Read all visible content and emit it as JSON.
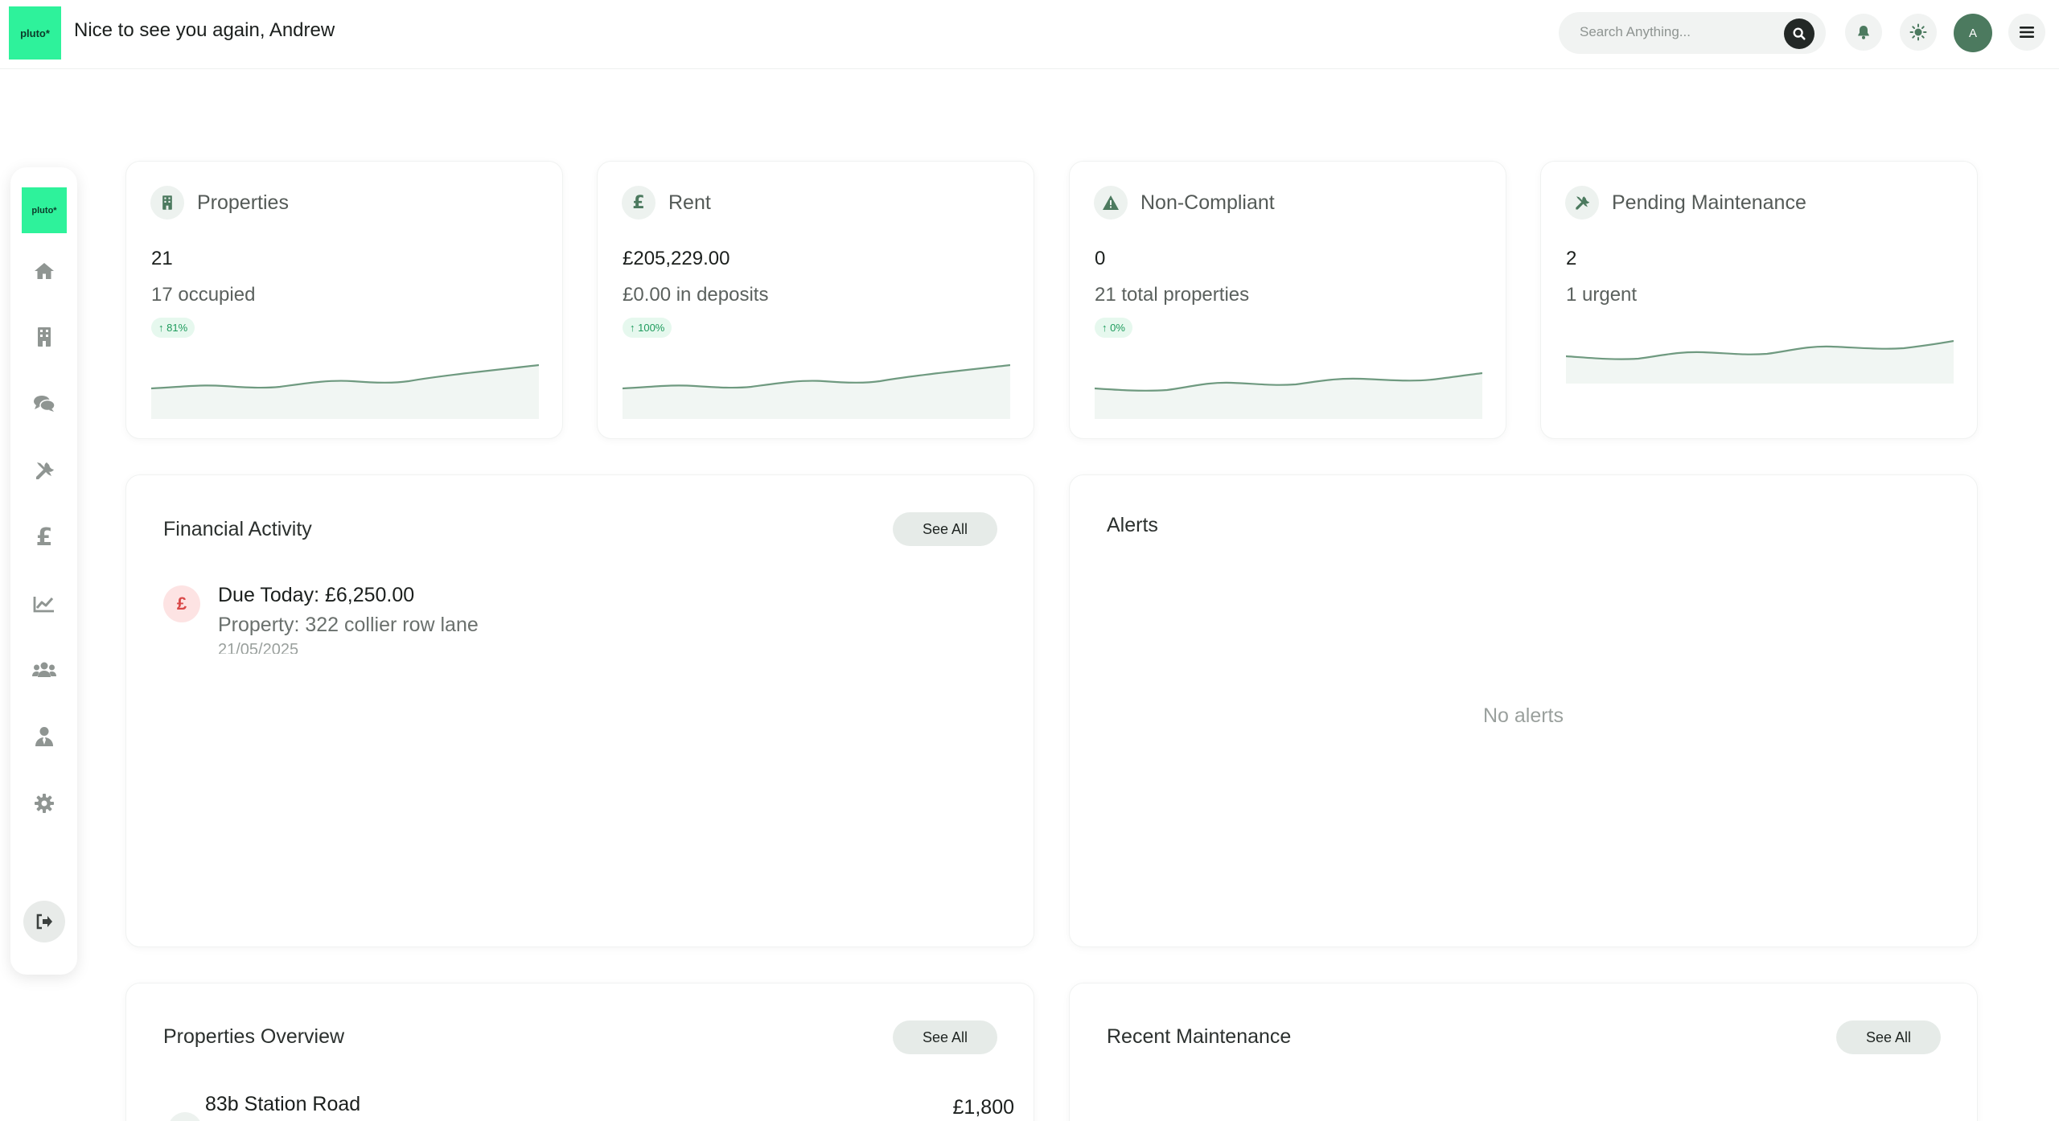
{
  "header": {
    "logo_text": "pluto*",
    "welcome": "Nice to see you again, Andrew",
    "search_placeholder": "Search Anything...",
    "avatar_initial": "A"
  },
  "sidebar": {
    "logo_text": "pluto*",
    "items": [
      {
        "icon": "home-icon"
      },
      {
        "icon": "building-icon"
      },
      {
        "icon": "chat-icon"
      },
      {
        "icon": "tools-icon"
      },
      {
        "icon": "pound-icon"
      },
      {
        "icon": "chart-line-icon"
      },
      {
        "icon": "users-icon"
      },
      {
        "icon": "user-tie-icon"
      },
      {
        "icon": "gear-icon"
      }
    ],
    "logout_icon": "sign-out-icon"
  },
  "stats": [
    {
      "title": "Properties",
      "value": "21",
      "sub": "17 occupied",
      "badge": "↑ 81%",
      "icon": "building-icon"
    },
    {
      "title": "Rent",
      "value": "£205,229.00",
      "sub": "£0.00 in deposits",
      "badge": "↑ 100%",
      "icon": "pound-icon"
    },
    {
      "title": "Non-Compliant",
      "value": "0",
      "sub": "21 total properties",
      "badge": "↑ 0%",
      "icon": "warning-icon"
    },
    {
      "title": "Pending Maintenance",
      "value": "2",
      "sub": "1 urgent",
      "badge": "",
      "icon": "tools-icon"
    }
  ],
  "financial": {
    "title": "Financial Activity",
    "see_all": "See All",
    "items": [
      {
        "title": "Due Today: £6,250.00",
        "property": "Property: 322 collier row lane",
        "date": "21/05/2025",
        "icon": "pound-icon"
      }
    ]
  },
  "alerts": {
    "title": "Alerts",
    "empty": "No alerts"
  },
  "properties_overview": {
    "title": "Properties Overview",
    "see_all": "See All",
    "items": [
      {
        "name": "83b Station Road",
        "price": "£1,800"
      }
    ]
  },
  "recent_maintenance": {
    "title": "Recent Maintenance",
    "see_all": "See All"
  },
  "colors": {
    "brand": "#2ef29b",
    "accent": "#4c7a5f",
    "badge": "#1d9b5c"
  }
}
